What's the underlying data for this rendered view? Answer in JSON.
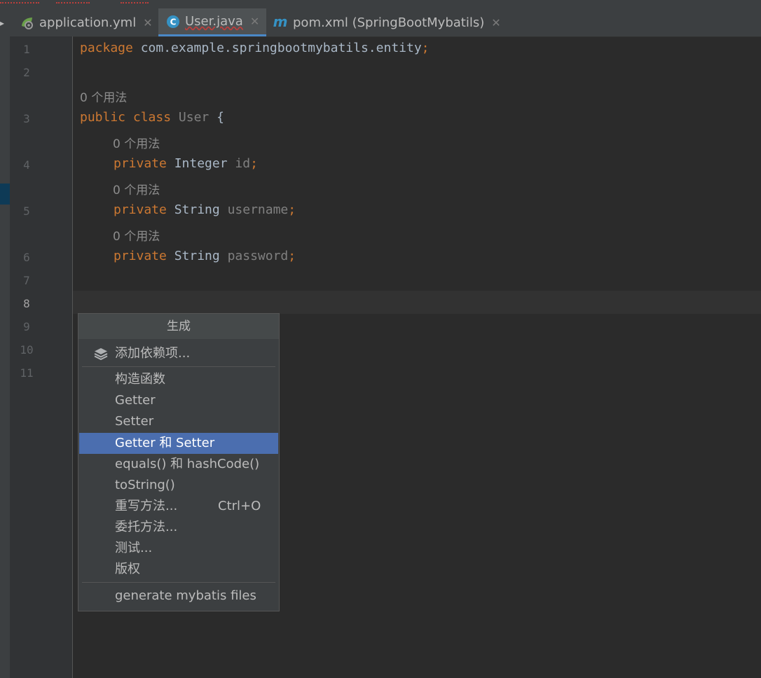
{
  "tabs": [
    {
      "label": "application.yml",
      "icon": "spring-yaml-icon",
      "active": false
    },
    {
      "label": "User.java",
      "icon": "java-class-icon",
      "active": true
    },
    {
      "label": "pom.xml (SpringBootMybatils)",
      "icon": "maven-icon",
      "active": false
    }
  ],
  "editor": {
    "line_numbers": [
      "1",
      "2",
      "3",
      "4",
      "5",
      "6",
      "7",
      "8",
      "9",
      "10",
      "11"
    ],
    "current_line": "8",
    "usage_hint": "0 个用法",
    "code": {
      "package_kw": "package",
      "package_name": " com.example.springbootmybatils.entity",
      "semicolon": ";",
      "public_kw": "public",
      "class_kw": "class",
      "class_name": "User",
      "open_brace": "{",
      "private_kw": "private",
      "fields": [
        {
          "type": "Integer",
          "name": "id"
        },
        {
          "type": "String",
          "name": "username"
        },
        {
          "type": "String",
          "name": "password"
        }
      ]
    }
  },
  "generate_menu": {
    "title": "生成",
    "items": [
      {
        "label": "添加依赖项...",
        "icon": "layers-icon"
      },
      {
        "label": "构造函数"
      },
      {
        "label": "Getter"
      },
      {
        "label": "Setter"
      },
      {
        "label": "Getter 和 Setter",
        "selected": true
      },
      {
        "label": "equals() 和 hashCode()"
      },
      {
        "label": "toString()"
      },
      {
        "label": "重写方法...",
        "shortcut": "Ctrl+O"
      },
      {
        "label": "委托方法..."
      },
      {
        "label": "测试..."
      },
      {
        "label": "版权"
      },
      {
        "label": "generate mybatis files"
      }
    ]
  },
  "colors": {
    "keyword": "#cc7832",
    "field": "#9876aa",
    "selection": "#4b6eaf",
    "tab_underline": "#4a88c7"
  }
}
